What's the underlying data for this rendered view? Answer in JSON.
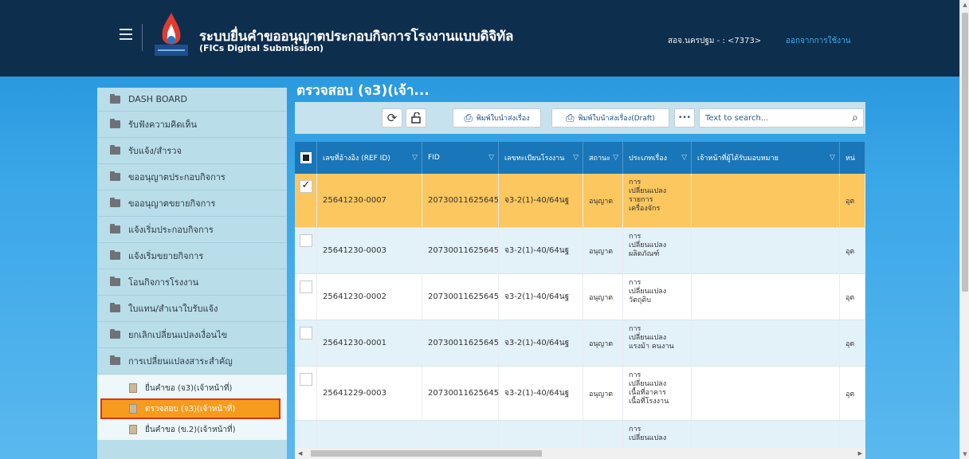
{
  "header": {
    "title": "ระบบยื่นคำขออนุญาตประกอบกิจการโรงงานแบบดิจิทัล",
    "subtitle": "(FICs Digital Submission)",
    "user": "สอจ.นครปฐม - : <7373>",
    "logout": "ออกจากการใช้งาน"
  },
  "sidebar": {
    "items": [
      {
        "label": "DASH BOARD"
      },
      {
        "label": "รับฟังความคิดเห็น"
      },
      {
        "label": "รับแจ้ง/สำรวจ"
      },
      {
        "label": "ขออนุญาตประกอบกิจการ"
      },
      {
        "label": "ขออนุญาตขยายกิจการ"
      },
      {
        "label": "แจ้งเริ่มประกอบกิจการ"
      },
      {
        "label": "แจ้งเริ่มขยายกิจการ"
      },
      {
        "label": "โอนกิจการโรงงาน"
      },
      {
        "label": "ใบแทน/สำเนาใบรับแจ้ง"
      },
      {
        "label": "ยกเลิกเปลี่ยนแปลงเงื่อนไข"
      },
      {
        "label": "การเปลี่ยนแปลงสาระสำคัญ"
      }
    ],
    "sub_items": [
      {
        "label": "ยื่นคำขอ (จ3)(เจ้าหน้าที่)"
      },
      {
        "label": "ตรวจสอบ (จ3)(เจ้าหน้าที่)"
      },
      {
        "label": "ยื่นคำขอ (ข.2)(เจ้าหน้าที่)"
      }
    ]
  },
  "main": {
    "title": "ตรวจสอบ (จ3)(เจ้า...",
    "toolbar": {
      "print_label": "พิมพ์ใบนำส่งเรื่อง",
      "print_draft_label": "พิมพ์ใบนำส่งเรื่อง(Draft)",
      "more_label": "•••",
      "search_placeholder": "Text to search..."
    },
    "columns": [
      "เลขที่อ้างอิง (REF ID)",
      "FID",
      "เลขทะเบียนโรงงาน",
      "สถานะ",
      "ประเภทเรื่อง",
      "เจ้าหน้าที่ผู้ได้รับมอบหมาย",
      "หน่"
    ],
    "rows": [
      {
        "ref": "25641230-0007",
        "fid": "20730011625645",
        "reg": "จ3-2(1)-40/64นฐ",
        "status": "อนุญาต",
        "type": "การ\nเปลี่ยนแปลง\nรายการ\nเครื่องจักร",
        "officer": "",
        "unit": "อุต"
      },
      {
        "ref": "25641230-0003",
        "fid": "20730011625645",
        "reg": "จ3-2(1)-40/64นฐ",
        "status": "อนุญาต",
        "type": "การ\nเปลี่ยนแปลง\nผลิตภัณฑ์",
        "officer": "",
        "unit": "อุต"
      },
      {
        "ref": "25641230-0002",
        "fid": "20730011625645",
        "reg": "จ3-2(1)-40/64นฐ",
        "status": "อนุญาต",
        "type": "การ\nเปลี่ยนแปลง\nวัตถุดิบ",
        "officer": "",
        "unit": "อุต"
      },
      {
        "ref": "25641230-0001",
        "fid": "20730011625645",
        "reg": "จ3-2(1)-40/64นฐ",
        "status": "อนุญาต",
        "type": "การ\nเปลี่ยนแปลง\nแรงม้า คนงาน",
        "officer": "",
        "unit": "อุต"
      },
      {
        "ref": "25641229-0003",
        "fid": "20730011625645",
        "reg": "จ3-2(1)-40/64นฐ",
        "status": "อนุญาต",
        "type": "การ\nเปลี่ยนแปลง\nเนื้อที่อาคาร\nเนื้อที่โรงงาน",
        "officer": "",
        "unit": "อุต"
      },
      {
        "ref": "",
        "fid": "",
        "reg": "",
        "status": "",
        "type": "การ\nเปลี่ยนแปลง",
        "officer": "",
        "unit": ""
      }
    ]
  },
  "colors": {
    "header_bg": "#0e2e4e",
    "grid_header": "#1976b8",
    "selected_row": "#fbc75e",
    "active_sub": "#f79b1d"
  }
}
